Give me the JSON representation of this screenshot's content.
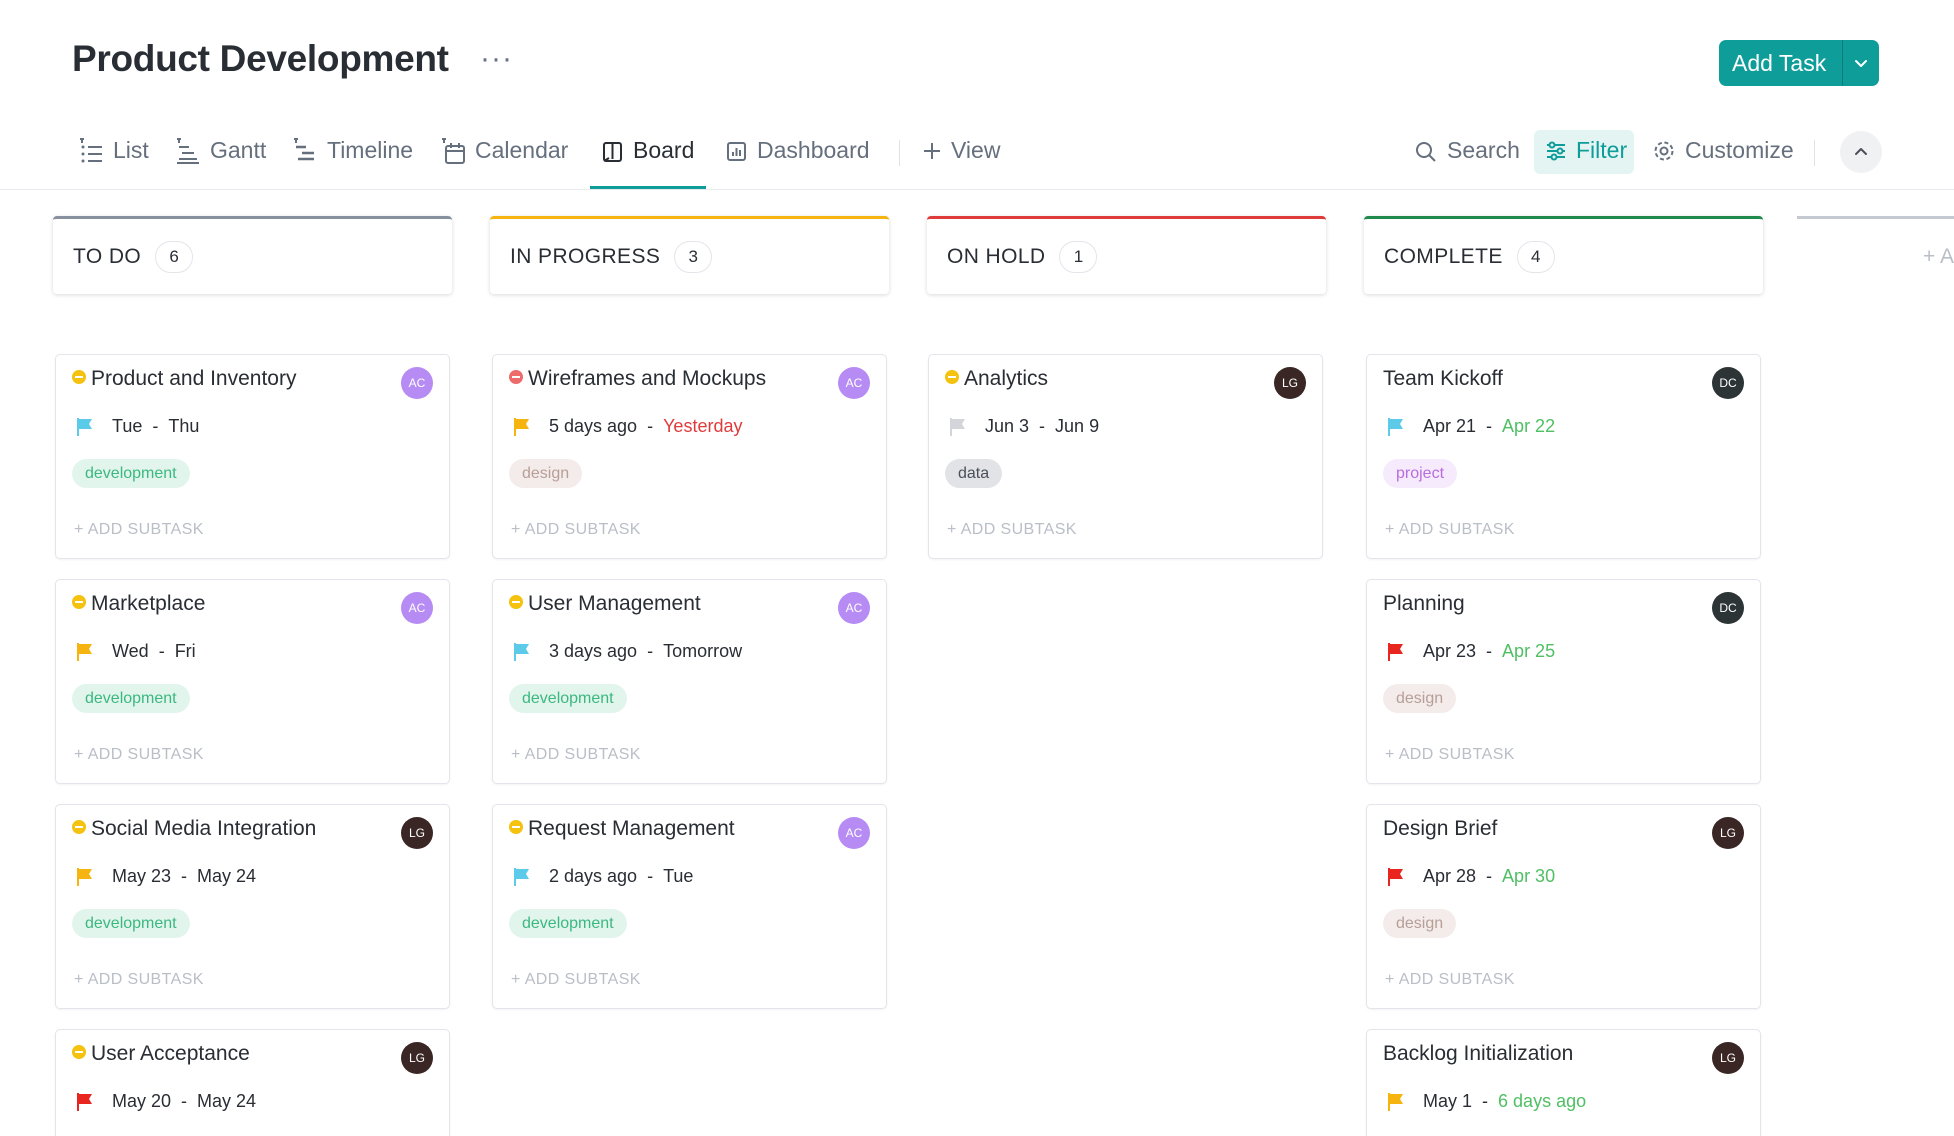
{
  "header": {
    "title": "Product Development",
    "more_label": "···",
    "add_task_label": "Add Task"
  },
  "tabs": [
    {
      "label": "List",
      "icon": "list-icon"
    },
    {
      "label": "Gantt",
      "icon": "gantt-icon"
    },
    {
      "label": "Timeline",
      "icon": "timeline-icon"
    },
    {
      "label": "Calendar",
      "icon": "calendar-icon"
    },
    {
      "label": "Board",
      "icon": "board-icon",
      "active": true
    },
    {
      "label": "Dashboard",
      "icon": "dashboard-icon"
    },
    {
      "label": "View",
      "icon": "plus-icon"
    }
  ],
  "toolbar": {
    "search_label": "Search",
    "filter_label": "Filter",
    "customize_label": "Customize"
  },
  "colors": {
    "accent": "#0f9d9a",
    "todo": "#87909e",
    "in_progress": "#f5b40f",
    "on_hold": "#e03b3b",
    "complete": "#1f8a4c",
    "tag_development_bg": "#e2f5ec",
    "tag_development_fg": "#3bb880",
    "tag_design_bg": "#f4ecea",
    "tag_design_fg": "#b79e97",
    "tag_data_bg": "#e2e3e6",
    "tag_data_fg": "#4a4f5a",
    "tag_project_bg": "#f6eafd",
    "tag_project_fg": "#b86ede",
    "date_red": "#e03b3b",
    "date_green": "#4fbf63"
  },
  "columns": [
    {
      "name": "TO DO",
      "count": "6",
      "cards": [
        {
          "title": "Product and Inventory",
          "status_color": "#f5c20f",
          "avatar": "AC",
          "avatar_color": "#b68cf4",
          "flag": "#5ccbea",
          "start": "Tue",
          "end": "Thu",
          "tag": "development",
          "subtask": "+ ADD SUBTASK"
        },
        {
          "title": "Marketplace",
          "status_color": "#f5c20f",
          "avatar": "AC",
          "avatar_color": "#b68cf4",
          "flag": "#f5b40f",
          "start": "Wed",
          "end": "Fri",
          "tag": "development",
          "subtask": "+ ADD SUBTASK"
        },
        {
          "title": "Social Media Integration",
          "status_color": "#f5c20f",
          "avatar": "LG",
          "avatar_color": "#3a2725",
          "flag": "#f5b40f",
          "start": "May 23",
          "end": "May 24",
          "tag": "development",
          "subtask": "+ ADD SUBTASK"
        },
        {
          "title": "User Acceptance",
          "status_color": "#f5c20f",
          "avatar": "LG",
          "avatar_color": "#3a2725",
          "flag": "#e8251f",
          "start": "May 20",
          "end": "May 24",
          "tag": "",
          "subtask": ""
        }
      ]
    },
    {
      "name": "IN PROGRESS",
      "count": "3",
      "cards": [
        {
          "title": "Wireframes and Mockups",
          "status_color": "#ee6b6b",
          "avatar": "AC",
          "avatar_color": "#b68cf4",
          "flag": "#f5b40f",
          "start": "5 days ago",
          "end": "Yesterday",
          "end_color": "#e03b3b",
          "tag": "design",
          "subtask": "+ ADD SUBTASK"
        },
        {
          "title": "User Management",
          "status_color": "#f5c20f",
          "avatar": "AC",
          "avatar_color": "#b68cf4",
          "flag": "#5ccbea",
          "start": "3 days ago",
          "end": "Tomorrow",
          "tag": "development",
          "subtask": "+ ADD SUBTASK"
        },
        {
          "title": "Request Management",
          "status_color": "#f5c20f",
          "avatar": "AC",
          "avatar_color": "#b68cf4",
          "flag": "#5ccbea",
          "start": "2 days ago",
          "end": "Tue",
          "tag": "development",
          "subtask": "+ ADD SUBTASK"
        }
      ]
    },
    {
      "name": "ON HOLD",
      "count": "1",
      "cards": [
        {
          "title": "Analytics",
          "status_color": "#f5c20f",
          "avatar": "LG",
          "avatar_color": "#3a2725",
          "flag": "#d3d5da",
          "start": "Jun 3",
          "end": "Jun 9",
          "tag": "data",
          "subtask": "+ ADD SUBTASK"
        }
      ]
    },
    {
      "name": "COMPLETE",
      "count": "4",
      "cards": [
        {
          "title": "Team Kickoff",
          "status_color": "",
          "avatar": "DC",
          "avatar_color": "#2d3436",
          "flag": "#5ccbea",
          "start": "Apr 21",
          "end": "Apr 22",
          "end_color": "#4fbf63",
          "tag": "project",
          "subtask": "+ ADD SUBTASK"
        },
        {
          "title": "Planning",
          "status_color": "",
          "avatar": "DC",
          "avatar_color": "#2d3436",
          "flag": "#e8251f",
          "start": "Apr 23",
          "end": "Apr 25",
          "end_color": "#4fbf63",
          "tag": "design",
          "subtask": "+ ADD SUBTASK"
        },
        {
          "title": "Design Brief",
          "status_color": "",
          "avatar": "LG",
          "avatar_color": "#3a2725",
          "flag": "#e8251f",
          "start": "Apr 28",
          "end": "Apr 30",
          "end_color": "#4fbf63",
          "tag": "design",
          "subtask": "+ ADD SUBTASK"
        },
        {
          "title": "Backlog Initialization",
          "status_color": "",
          "avatar": "LG",
          "avatar_color": "#3a2725",
          "flag": "#f5b40f",
          "start": "May 1",
          "end": "6 days ago",
          "end_color": "#4fbf63",
          "tag": "",
          "subtask": ""
        }
      ]
    }
  ],
  "ghost_column_label": "+ A"
}
